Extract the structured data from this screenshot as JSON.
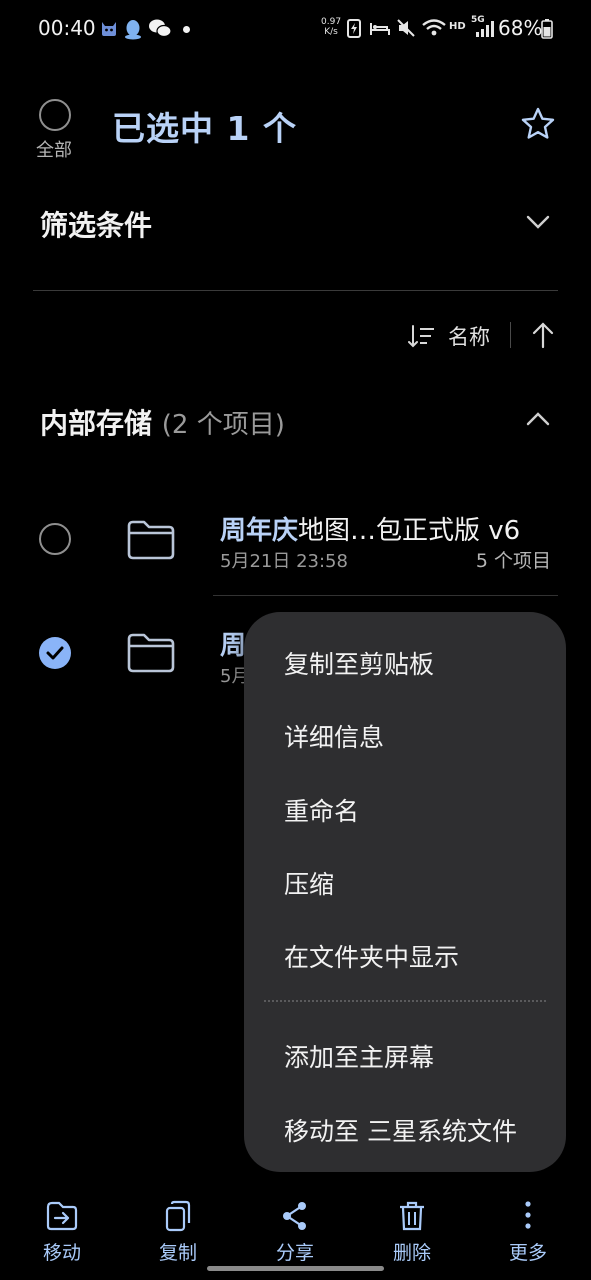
{
  "status_bar": {
    "time": "00:40",
    "net_speed_value": "0.97",
    "net_speed_unit": "K/s",
    "network_hd": "HD",
    "network_5g": "5G",
    "battery": "68%"
  },
  "header": {
    "select_all_label": "全部",
    "selected_title": "已选中 1 个"
  },
  "filter": {
    "label": "筛选条件"
  },
  "sort": {
    "label": "名称"
  },
  "storage": {
    "title": "内部存储",
    "count": "(2 个项目)"
  },
  "items": [
    {
      "name_highlight": "周年庆",
      "name_rest": "地图…包正式版 v6",
      "date": "5月21日 23:58",
      "count": "5 个项目",
      "checked": false
    },
    {
      "name_highlight": "周",
      "name_rest": "",
      "date": "5月",
      "count": "",
      "checked": true
    }
  ],
  "context_menu": {
    "items": [
      "复制至剪贴板",
      "详细信息",
      "重命名",
      "压缩",
      "在文件夹中显示",
      "添加至主屏幕",
      "移动至 三星系统文件"
    ]
  },
  "bottom_bar": {
    "items": [
      "移动",
      "复制",
      "分享",
      "删除",
      "更多"
    ]
  },
  "colors": {
    "accent": "#8ab4f8",
    "accent_text": "#b9d2f7",
    "menu_bg": "#2e2e30",
    "background": "#000000"
  }
}
